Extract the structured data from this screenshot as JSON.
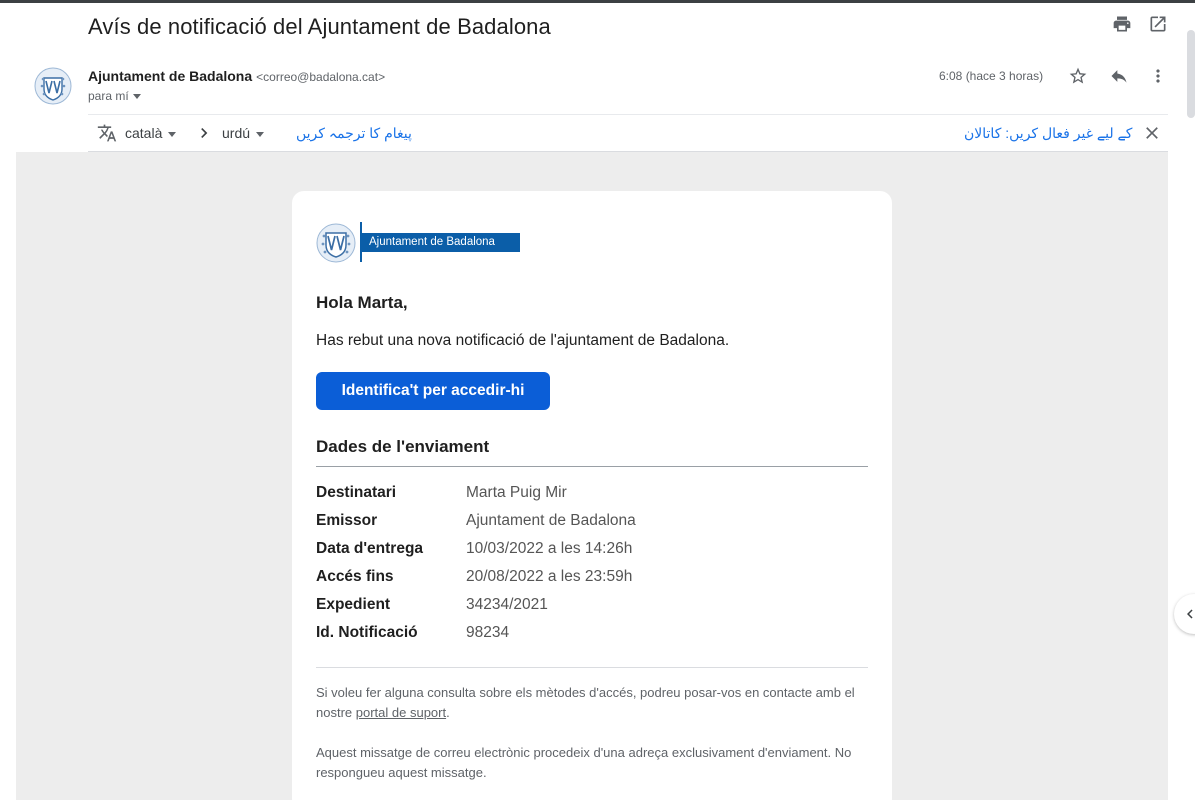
{
  "email": {
    "subject": "Avís de notificació del Ajuntament de Badalona",
    "sender_name": "Ajuntament de Badalona",
    "sender_email": "<correo@badalona.cat>",
    "to_label": "para mí",
    "time": "6:08 (hace 3 horas)"
  },
  "translate_bar": {
    "source_lang": "català",
    "target_lang": "urdú",
    "translate_link": "پیغام کا ترجمہ کریں",
    "disable_link": "کے لیے غیر فعال کریں: کاتالان"
  },
  "body": {
    "logo_label": "Ajuntament de Badalona",
    "greeting": "Hola Marta,",
    "intro": "Has rebut una nova notificació de l'ajuntament de Badalona.",
    "cta_label": "Identifica't per accedir-hi",
    "section_title": "Dades de l'enviament",
    "details": [
      {
        "label": "Destinatari",
        "value": "Marta Puig Mir"
      },
      {
        "label": "Emissor",
        "value": "Ajuntament de Badalona"
      },
      {
        "label": "Data d'entrega",
        "value": "10/03/2022 a les 14:26h"
      },
      {
        "label": "Accés fins",
        "value": "20/08/2022 a les 23:59h"
      },
      {
        "label": "Expedient",
        "value": "34234/2021"
      },
      {
        "label": "Id. Notificació",
        "value": "98234"
      }
    ],
    "footer_text_1": "Si voleu fer alguna consulta sobre els mètodes d'accés, podreu posar-vos en contacte amb el nostre",
    "footer_link": "portal de suport",
    "footer_text_1_end": ".",
    "footer_text_2": "Aquest missatge de correu electrònic procedeix d'una adreça exclusivament d'enviament. No respongueu aquest missatge."
  },
  "icons": {
    "print": "print-icon",
    "open_new": "open-in-new-window-icon",
    "star": "star-icon",
    "reply": "reply-icon",
    "more": "more-vertical-icon",
    "translate": "translate-icon",
    "arrow": "chevron-right-icon",
    "close": "close-icon",
    "collapse": "chevron-left-icon",
    "emblem": "badalona-coat-of-arms-icon"
  },
  "colors": {
    "accent_blue": "#0b5ed7",
    "logo_blue": "#0b5ea8",
    "link_blue": "#1a73e8",
    "background_grey": "#ededed"
  }
}
